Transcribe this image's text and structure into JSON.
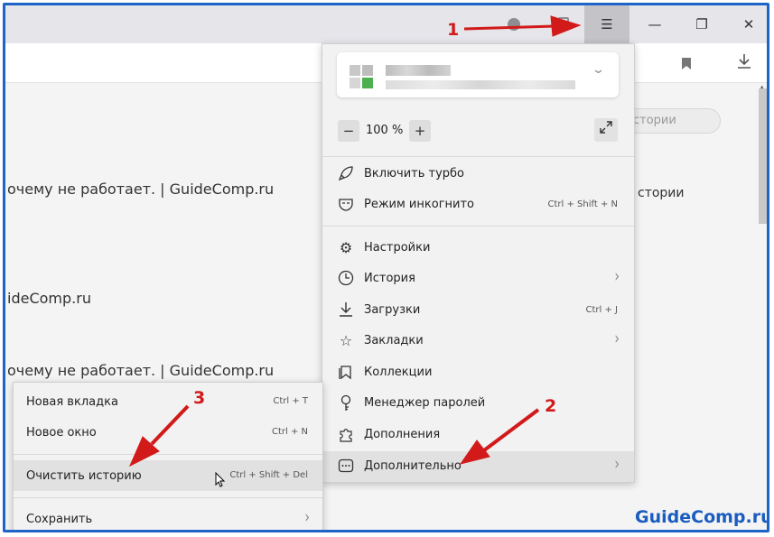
{
  "window": {
    "menu_icon": "hamburger-icon",
    "minimize": "—",
    "maximize": "❐",
    "close": "✕"
  },
  "page": {
    "history_lines": [
      "очему не работает. | GuideComp.ru",
      "ideComp.ru",
      "очему не работает. | GuideComp.ru"
    ],
    "search_placeholder": "стории",
    "side_text": "стории"
  },
  "main_menu": {
    "zoom": {
      "minus": "−",
      "value": "100 %",
      "plus": "+"
    },
    "items": [
      {
        "icon": "rocket-icon",
        "label": "Включить турбо",
        "shortcut": "",
        "arrow": false
      },
      {
        "icon": "mask-icon",
        "label": "Режим инкогнито",
        "shortcut": "Ctrl + Shift + N",
        "arrow": false
      },
      {
        "icon": "gear-icon",
        "label": "Настройки",
        "shortcut": "",
        "arrow": false
      },
      {
        "icon": "clock-icon",
        "label": "История",
        "shortcut": "",
        "arrow": true
      },
      {
        "icon": "download-icon",
        "label": "Загрузки",
        "shortcut": "Ctrl + J",
        "arrow": false
      },
      {
        "icon": "star-icon",
        "label": "Закладки",
        "shortcut": "",
        "arrow": true
      },
      {
        "icon": "collections-icon",
        "label": "Коллекции",
        "shortcut": "",
        "arrow": false
      },
      {
        "icon": "key-icon",
        "label": "Менеджер паролей",
        "shortcut": "",
        "arrow": false
      },
      {
        "icon": "puzzle-icon",
        "label": "Дополнения",
        "shortcut": "",
        "arrow": false
      },
      {
        "icon": "more-icon",
        "label": "Дополнительно",
        "shortcut": "",
        "arrow": true
      }
    ]
  },
  "sub_menu": {
    "items": [
      {
        "label": "Новая вкладка",
        "shortcut": "Ctrl + T"
      },
      {
        "label": "Новое окно",
        "shortcut": "Ctrl + N"
      },
      {
        "label": "Очистить историю",
        "shortcut": "Ctrl + Shift + Del"
      },
      {
        "label": "Сохранить",
        "shortcut": ""
      }
    ]
  },
  "annotations": {
    "n1": "1",
    "n2": "2",
    "n3": "3",
    "color": "#d21a1a"
  },
  "watermark": "GuideComp.ru"
}
